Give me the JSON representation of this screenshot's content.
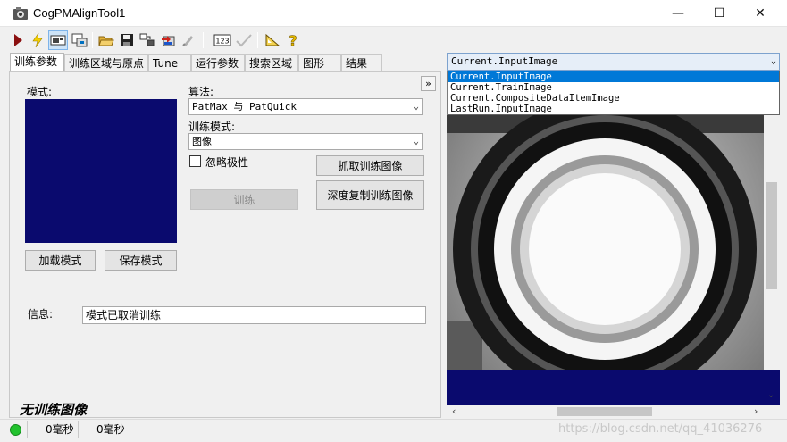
{
  "window": {
    "title": "CogPMAlignTool1",
    "minimize": "—",
    "maximize": "☐",
    "close": "✕"
  },
  "toolbar": {
    "buttons": [
      "run-icon",
      "lightning-icon",
      "toggle-display-icon",
      "settings-icon",
      "open-folder-icon",
      "save-icon",
      "export-icon",
      "import-icon",
      "edit-icon",
      "numeric-icon",
      "check-icon",
      "scale-icon",
      "help-icon"
    ]
  },
  "tabs": [
    "训练参数",
    "训练区域与原点",
    "Tune",
    "运行参数",
    "搜索区域",
    "图形",
    "结果"
  ],
  "train": {
    "model_label": "模式:",
    "load_button": "加载模式",
    "save_button": "保存模式",
    "algorithm_label": "算法:",
    "algorithm_value": "PatMax 与 PatQuick",
    "train_mode_label": "训练模式:",
    "train_mode_value": "图像",
    "ignore_polarity_label": "忽略极性",
    "grab_button": "抓取训练图像",
    "train_button": "训练",
    "deep_copy_button": "深度复制训练图像",
    "info_label": "信息:",
    "info_value": "模式已取消训练",
    "no_train_image": "无训练图像",
    "collapse_icon": "»"
  },
  "image_view": {
    "selected": "Current.InputImage",
    "options": [
      "Current.InputImage",
      "Current.TrainImage",
      "Current.CompositeDataItemImage",
      "LastRun.InputImage"
    ]
  },
  "status": {
    "time1": "0毫秒",
    "time2": "0毫秒",
    "indicator_color": "#22c22e"
  },
  "watermark": "https://blog.csdn.net/qq_41036276"
}
